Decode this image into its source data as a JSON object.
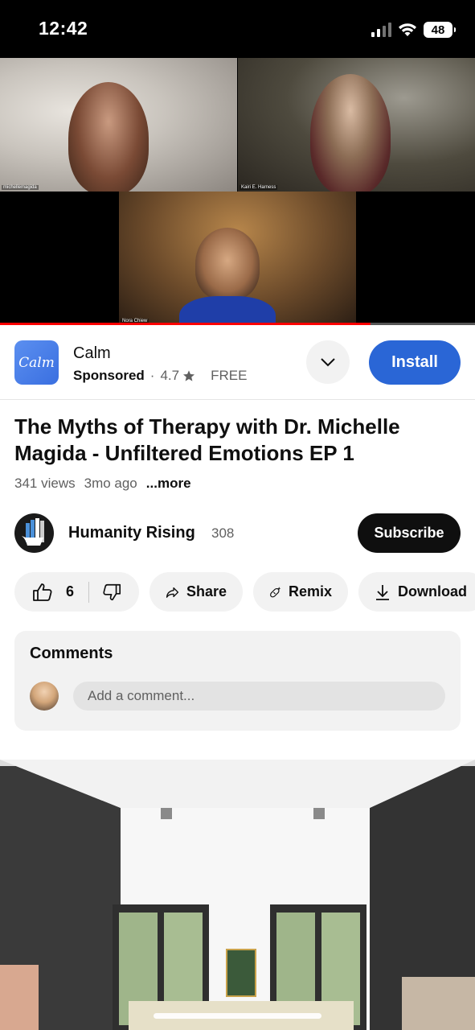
{
  "status_bar": {
    "time": "12:42",
    "battery": "48"
  },
  "video": {
    "participants": [
      "michellemagida",
      "Kairi E. Harness",
      "Nora Chiew"
    ],
    "progress_fraction": 0.78
  },
  "ad": {
    "app_name": "Calm",
    "logo_text": "Calm",
    "sponsored": "Sponsored",
    "rating": "4.7",
    "price": "FREE",
    "install_label": "Install",
    "brand_color": "#2a66d6"
  },
  "video_info": {
    "title": "The Myths of Therapy with Dr. Michelle Magida - Unfiltered Emotions EP 1",
    "views": "341 views",
    "age": "3mo ago",
    "more": "...more"
  },
  "channel": {
    "name": "Humanity Rising",
    "subscribers": "308",
    "subscribe_label": "Subscribe"
  },
  "actions": {
    "likes": "6",
    "share": "Share",
    "remix": "Remix",
    "download": "Download"
  },
  "comments": {
    "title": "Comments",
    "placeholder": "Add a comment..."
  }
}
